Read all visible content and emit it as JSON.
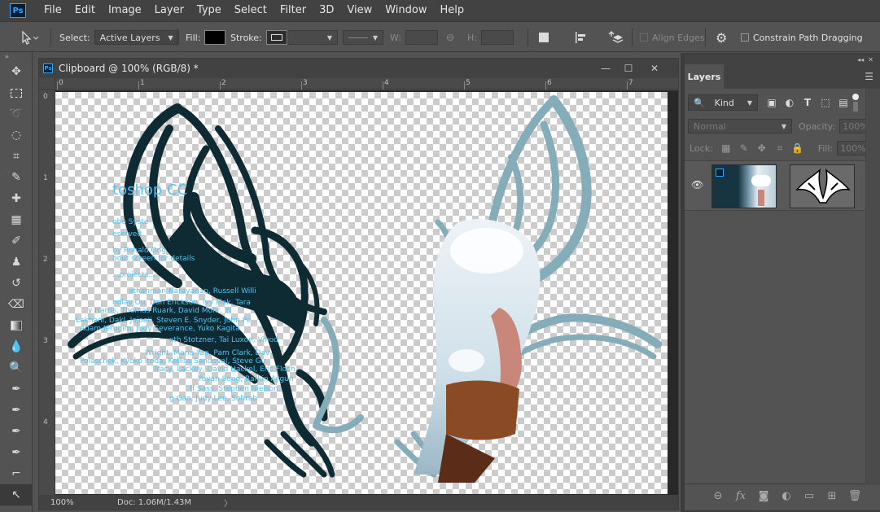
{
  "app": {
    "logo": "Ps"
  },
  "menu": [
    "File",
    "Edit",
    "Image",
    "Layer",
    "Type",
    "Select",
    "Filter",
    "3D",
    "View",
    "Window",
    "Help"
  ],
  "options": {
    "select_label": "Select:",
    "select_value": "Active Layers",
    "fill_label": "Fill:",
    "stroke_label": "Stroke:",
    "w_label": "W:",
    "h_label": "H:",
    "align_edges": "Align Edges",
    "constrain": "Constrain Path Dragging",
    "fill_color": "#000000"
  },
  "document": {
    "title": "Clipboard @ 100% (RGB/8) *",
    "zoom": "100%",
    "doc_size": "Doc: 1.06M/1.43M",
    "ruler_top": [
      "0",
      "1",
      "2",
      "3",
      "4",
      "5",
      "6",
      "7"
    ],
    "ruler_left": [
      "0",
      "1",
      "2",
      "3",
      "4"
    ],
    "credits": [
      "toshop CC",
      "obe Syste",
      "eserved.",
      "by Ronald Ong",
      "bout screen for details",
      "...projects...",
      "athanman Narayanan, Russell Willi",
      "ndlay Ou,  Dan Erickson, Ivy Mak, Tara",
      "y Harris,  Thomas Ruark, David Mohr, Yi",
      "Lakhani,  Dakl, Jojoeii, Steven E. Snyder, John Pe",
      "Adam Jerugim,  Judy Severance, Yuko Kagita",
      "xth Stotzner, Tai Luxon, Vinod",
      "Wright, Maria Yap, Pam Clark, Dav",
      "Polaschek, Kyoko Itoda, Kellisa Sandoval, Steve Gu",
      "Tracy, Lackey, David Hackel, Eric Floch,",
      "Yuyan Song, Barkin Aygun",
      "ff Sass, Stephen Nielson,",
      "g Gao, Judy Lee, Sohrab"
    ]
  },
  "layers_panel": {
    "tab": "Layers",
    "filter_kind": "Kind",
    "blend_mode": "Normal",
    "opacity_label": "Opacity:",
    "opacity_value": "100%",
    "lock_label": "Lock:",
    "fill_label": "Fill:",
    "fill_value": "100%"
  },
  "colors": {
    "accent": "#31a8ff",
    "eagle_dark": "#0e2a33",
    "eagle_light": "#7fa9b5"
  }
}
